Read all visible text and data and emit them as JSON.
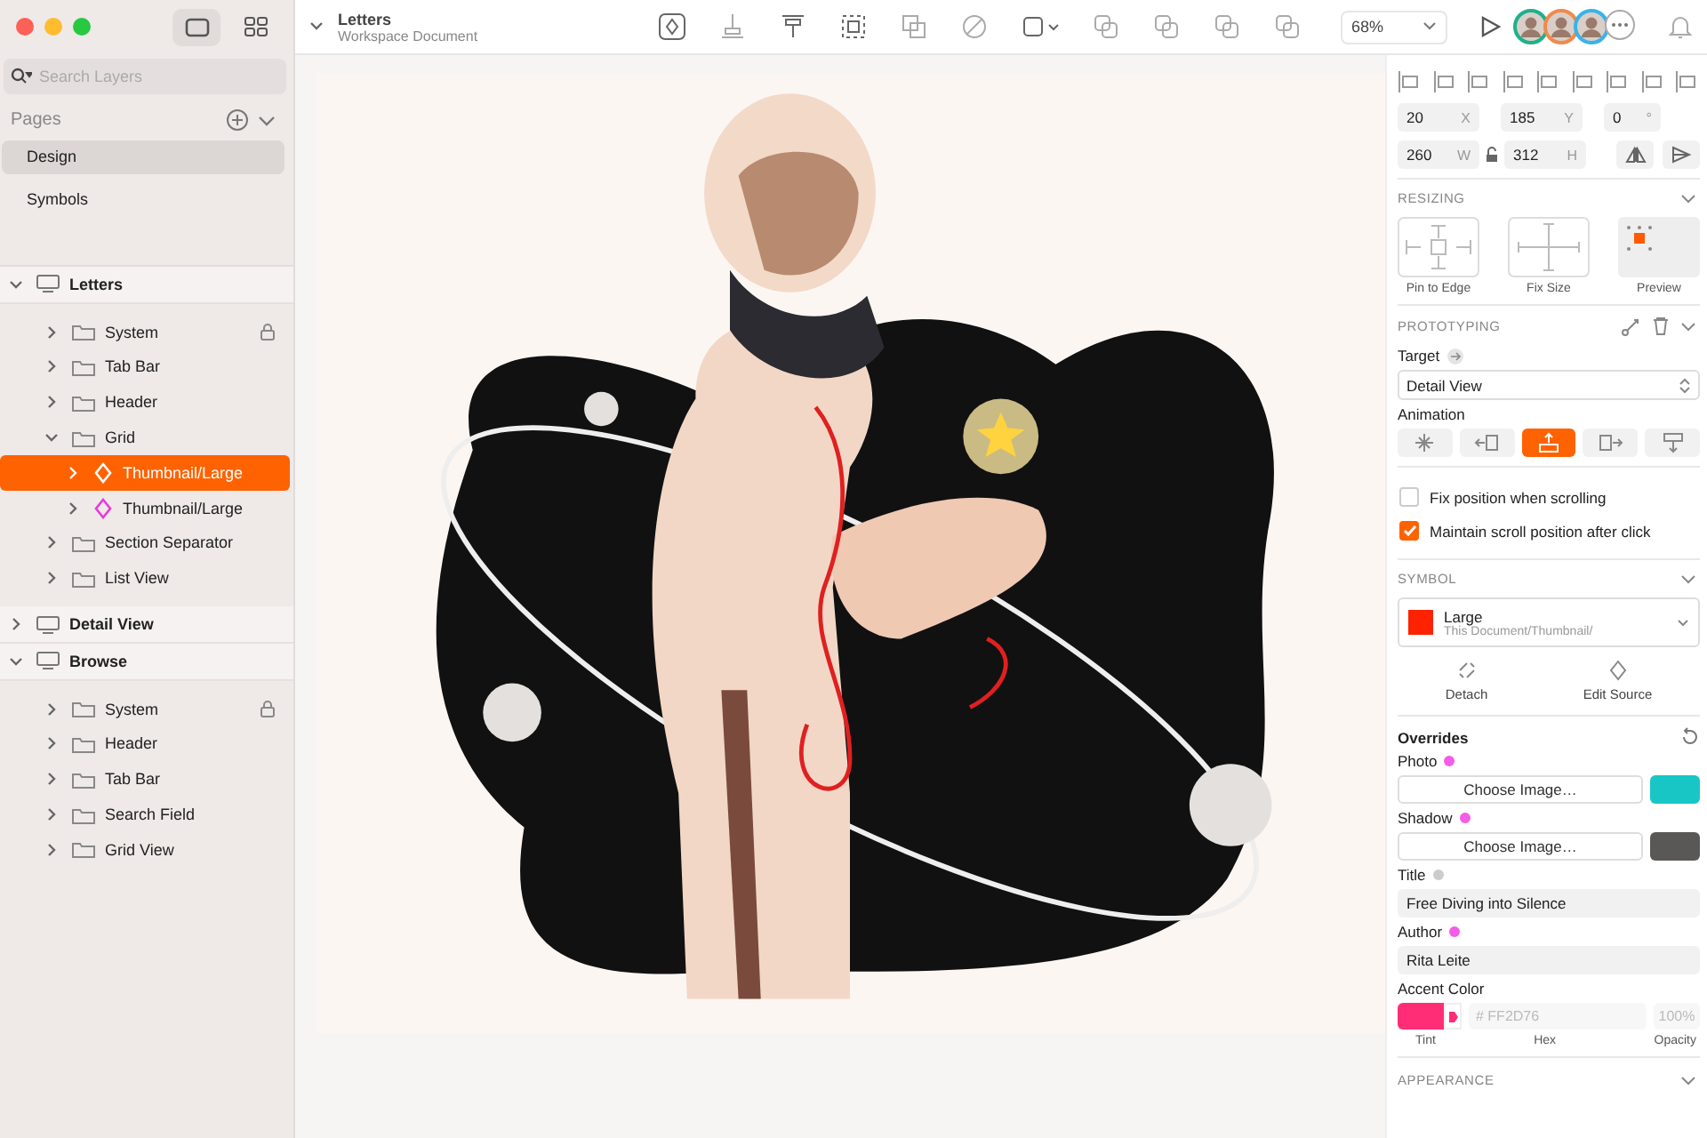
{
  "document": {
    "title": "Letters",
    "subtitle": "Workspace Document"
  },
  "toolbar": {
    "zoom": "68%"
  },
  "sidebar": {
    "search": {
      "placeholder": "Search Layers"
    },
    "pages_title": "Pages",
    "pages": [
      {
        "label": "Design",
        "selected": true
      },
      {
        "label": "Symbols",
        "selected": false
      }
    ],
    "layers": [
      {
        "name": "Letters",
        "kind": "artboard",
        "expanded": true,
        "selected": false,
        "locked": false,
        "children": [
          {
            "name": "System",
            "kind": "group",
            "expanded": false,
            "selected": false,
            "locked": true
          },
          {
            "name": "Tab Bar",
            "kind": "group",
            "expanded": false,
            "selected": false,
            "locked": false
          },
          {
            "name": "Header",
            "kind": "group",
            "expanded": false,
            "selected": false,
            "locked": false
          },
          {
            "name": "Grid",
            "kind": "group",
            "expanded": true,
            "selected": false,
            "locked": false,
            "children": [
              {
                "name": "Thumbnail/Large",
                "kind": "symbol",
                "expanded": false,
                "selected": true,
                "locked": false
              },
              {
                "name": "Thumbnail/Large",
                "kind": "symbol",
                "expanded": false,
                "selected": false,
                "locked": false
              }
            ]
          },
          {
            "name": "Section Separator",
            "kind": "group",
            "expanded": false,
            "selected": false,
            "locked": false
          },
          {
            "name": "List View",
            "kind": "group",
            "expanded": false,
            "selected": false,
            "locked": false
          }
        ]
      },
      {
        "name": "Detail View",
        "kind": "artboard",
        "expanded": false,
        "selected": false,
        "locked": false
      },
      {
        "name": "Browse",
        "kind": "artboard",
        "expanded": true,
        "selected": false,
        "locked": false,
        "children": [
          {
            "name": "System",
            "kind": "group",
            "expanded": false,
            "selected": false,
            "locked": true
          },
          {
            "name": "Header",
            "kind": "group",
            "expanded": false,
            "selected": false,
            "locked": false
          },
          {
            "name": "Tab Bar",
            "kind": "group",
            "expanded": false,
            "selected": false,
            "locked": false
          },
          {
            "name": "Search Field",
            "kind": "group",
            "expanded": false,
            "selected": false,
            "locked": false
          },
          {
            "name": "Grid View",
            "kind": "group",
            "expanded": false,
            "selected": false,
            "locked": false
          }
        ]
      }
    ]
  },
  "inspector": {
    "position": [
      {
        "value": "20",
        "label": "X"
      },
      {
        "value": "185",
        "label": "Y"
      },
      {
        "value": "0",
        "label": "°"
      }
    ],
    "size": [
      {
        "value": "260",
        "label": "W"
      },
      {
        "value": "312",
        "label": "H"
      }
    ],
    "resizing": {
      "title": "RESIZING",
      "tiles": [
        "Pin to Edge",
        "Fix Size",
        "Preview"
      ]
    },
    "prototyping": {
      "title": "PROTOTYPING",
      "target_label": "Target",
      "target": "Detail View",
      "animation_label": "Animation",
      "animations": [
        {
          "kind": "none",
          "selected": false
        },
        {
          "kind": "from-right",
          "selected": false
        },
        {
          "kind": "from-bottom",
          "selected": true
        },
        {
          "kind": "from-left",
          "selected": false
        },
        {
          "kind": "from-top",
          "selected": false
        }
      ],
      "options": [
        {
          "label": "Fix position when scrolling",
          "checked": false
        },
        {
          "label": "Maintain scroll position after click",
          "checked": true
        }
      ]
    },
    "symbol": {
      "title": "SYMBOL",
      "name": "Large",
      "path": "This Document/Thumbnail/",
      "actions": [
        {
          "kind": "detach",
          "label": "Detach"
        },
        {
          "kind": "edit",
          "label": "Edit Source"
        }
      ]
    },
    "overrides": {
      "title": "Overrides",
      "items": [
        {
          "kind": "image",
          "label": "Photo",
          "active": true,
          "button": "Choose Image…"
        },
        {
          "kind": "swatch",
          "label": "Shadow",
          "active": true,
          "button": "Choose Image…"
        },
        {
          "kind": "text",
          "label": "Title",
          "active": false,
          "value": "Free Diving into Silence"
        },
        {
          "kind": "text",
          "label": "Author",
          "active": true,
          "value": "Rita Leite"
        }
      ]
    },
    "accent": {
      "label": "Accent Color",
      "color": "#ff2d76",
      "hex": "# FF2D76",
      "opacity": "100%",
      "captions": [
        "Tint",
        "Hex",
        "Opacity"
      ]
    },
    "appearance_title": "APPEARANCE"
  }
}
